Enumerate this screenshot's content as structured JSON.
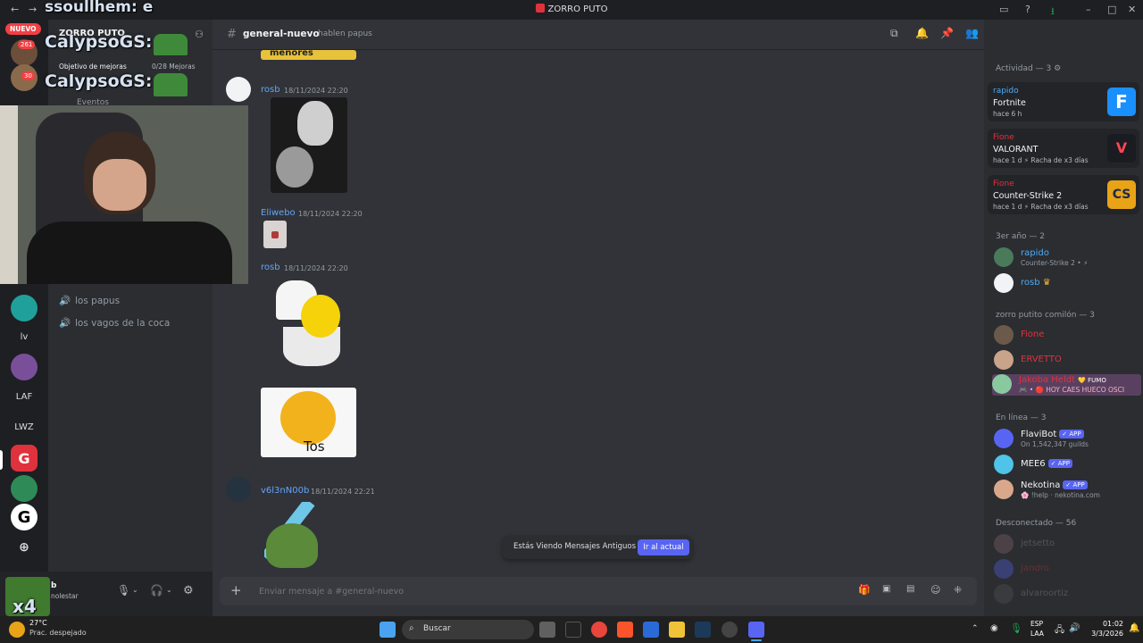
{
  "window": {
    "title": "ZORRO PUTO"
  },
  "overlay": {
    "chat_line_user": "ssoullhem:",
    "chat_line_text": "e",
    "alert_1": "CalypsoGS:",
    "alert_2": "CalypsoGS:",
    "badge_count": "x4"
  },
  "server": {
    "name": "ZORRO PUTO",
    "new_badge": "NUEVO",
    "badge_261": "261",
    "badge_30": "30",
    "goal_label": "Objetivo de mejoras",
    "goal_progress": "0/28 Mejoras",
    "events_label": "Eventos"
  },
  "server_list": [
    "lv",
    "LAF",
    "LWZ"
  ],
  "channels": [
    {
      "name": "los papus"
    },
    {
      "name": "los vagos de la coca"
    }
  ],
  "user_panel": {
    "name": "b",
    "status": "nolestar"
  },
  "chat": {
    "channel_name": "general-nuevo",
    "channel_topic": "hablen papus",
    "top_image_caption": "menores",
    "messages": [
      {
        "author": "rosb",
        "time": "18/11/2024 22:20"
      },
      {
        "author": "Eliwebo",
        "time": "18/11/2024 22:20"
      },
      {
        "author": "rosb",
        "time": "18/11/2024 22:20"
      },
      {
        "author": "v6l3nN00b",
        "time": "18/11/2024 22:21"
      }
    ],
    "sticker_text": "Tos",
    "jump_notice": "Estás Viendo Mensajes Antiguos",
    "jump_button": "Ir al actual",
    "input_placeholder": "Enviar mensaje a #general-nuevo"
  },
  "search": {
    "placeholder": "Buscar ZORRO PUTO"
  },
  "members": {
    "activity_header": "Actividad — 3",
    "activities": [
      {
        "user": "rapido",
        "game": "Fortnite",
        "status": "hace 6 h",
        "color": "#1a8fff"
      },
      {
        "user": "Fione",
        "game": "VALORANT",
        "status": "hace 1 d   ⚡ Racha de x3 días",
        "color": "#ff4655"
      },
      {
        "user": "Fione",
        "game": "Counter-Strike 2",
        "status": "hace 1 d   ⚡ Racha de x3 días",
        "color": "#e8a317"
      }
    ],
    "group1_header": "3er año — 2",
    "group1": [
      {
        "name": "rapido",
        "status": "Counter-Strike 2 • ⚡"
      },
      {
        "name": "rosb",
        "status": ""
      }
    ],
    "group2_header": "zorro putito comilón — 3",
    "group2": [
      {
        "name": "Fione",
        "status": ""
      },
      {
        "name": "ERVETTO",
        "status": ""
      },
      {
        "name": "Jakoba Heldt",
        "status": "🎮 • 🔴 HOY CAES HUECO OSCI",
        "tag": "💛 FUMO"
      }
    ],
    "online_header": "En línea — 3",
    "online": [
      {
        "name": "FlaviBot",
        "status": "On 1,542,347 guilds",
        "tag": "✓ APP"
      },
      {
        "name": "MEE6",
        "status": "",
        "tag": "✓ APP"
      },
      {
        "name": "Nekotina",
        "status": "🌸 !help · nekotina.com",
        "tag": "✓ APP"
      }
    ],
    "offline_header": "Desconectado — 56",
    "offline": [
      {
        "name": "jetsetto"
      },
      {
        "name": "Jandro"
      },
      {
        "name": "alvaroortiz"
      }
    ]
  },
  "taskbar": {
    "weather_temp": "27°C",
    "weather_desc": "Prac. despejado",
    "search_label": "Buscar",
    "lang": "ESP",
    "lang2": "LAA",
    "time": "01:02",
    "date": "3/3/2026"
  }
}
